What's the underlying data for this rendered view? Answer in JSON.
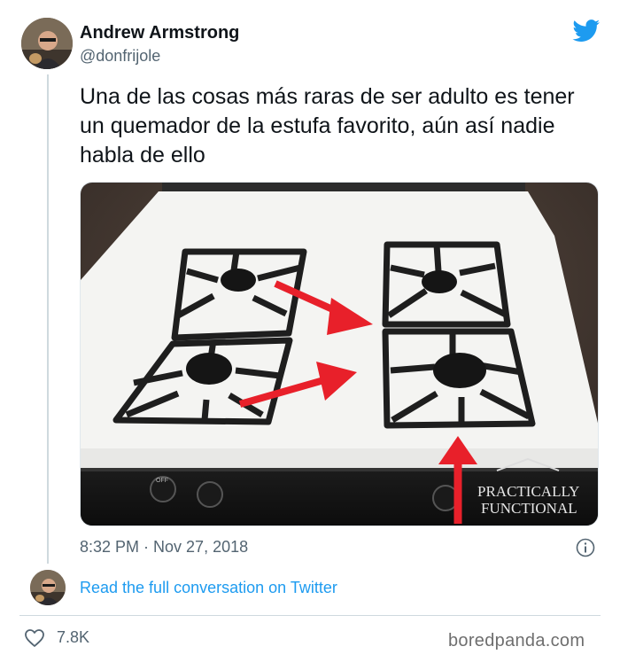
{
  "author": {
    "name": "Andrew Armstrong",
    "handle": "@donfrijole"
  },
  "tweet": {
    "text": "Una de las cosas más raras de ser adulto es tener un quemador de la estufa favorito, aún así nadie habla de ello",
    "timestamp": "8:32 PM · Nov 27, 2018"
  },
  "photo": {
    "watermark_line1": "PRACTICALLY",
    "watermark_line2": "FUNCTIONAL",
    "knob_label": "OFF",
    "arrow_color": "#e8202a"
  },
  "conversation_link": "Read the full conversation on Twitter",
  "likes": "7.8K",
  "site_mark": "boredpanda.com",
  "colors": {
    "brand": "#1d9bf0",
    "text": "#0f1419",
    "muted": "#536471"
  },
  "icons": [
    "twitter-bird-icon",
    "info-icon",
    "heart-icon"
  ]
}
